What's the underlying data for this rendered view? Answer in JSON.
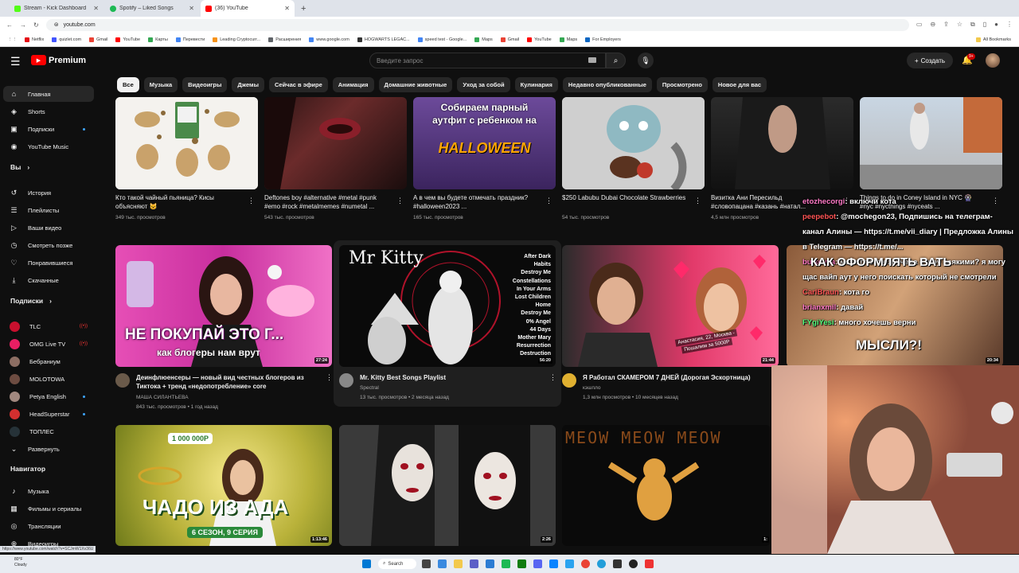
{
  "browser": {
    "tabs": [
      {
        "title": "Stream - Kick Dashboard",
        "color": "#53fc18"
      },
      {
        "title": "Spotify – Liked Songs",
        "color": "#1db954"
      },
      {
        "title": "(36) YouTube",
        "color": "#ff0000"
      }
    ],
    "url": "youtube.com",
    "bookmarks": [
      {
        "label": "Netflix",
        "color": "#e50914"
      },
      {
        "label": "quizlet.com",
        "color": "#4255ff"
      },
      {
        "label": "Gmail",
        "color": "#ea4335"
      },
      {
        "label": "YouTube",
        "color": "#ff0000"
      },
      {
        "label": "Карты",
        "color": "#34a853"
      },
      {
        "label": "Перевести",
        "color": "#4285f4"
      },
      {
        "label": "Leading Cryptocurr...",
        "color": "#f7931a"
      },
      {
        "label": "Расширения",
        "color": "#5f6368"
      },
      {
        "label": "www.google.com",
        "color": "#4285f4"
      },
      {
        "label": "HOGWARTS LEGAC...",
        "color": "#333333"
      },
      {
        "label": "speed test - Google...",
        "color": "#4285f4"
      },
      {
        "label": "Maps",
        "color": "#34a853"
      },
      {
        "label": "Gmail",
        "color": "#ea4335"
      },
      {
        "label": "YouTube",
        "color": "#ff0000"
      },
      {
        "label": "Maps",
        "color": "#34a853"
      },
      {
        "label": "For Employers",
        "color": "#0a66c2"
      }
    ],
    "all_bookmarks": "All Bookmarks",
    "status_url": "https://www.youtube.com/watch?v=SCJmW1Xv36U"
  },
  "header": {
    "logo_text": "Premium",
    "search_placeholder": "Введите запрос",
    "create_label": "Создать",
    "notif_badge": "9+"
  },
  "chips": [
    "Все",
    "Музыка",
    "Видеоигры",
    "Джемы",
    "Сейчас в эфире",
    "Анимация",
    "Домашние животные",
    "Уход за собой",
    "Кулинария",
    "Недавно опубликованные",
    "Просмотрено",
    "Новое для вас"
  ],
  "sidebar": {
    "main": [
      {
        "label": "Главная",
        "icon": "⌂"
      },
      {
        "label": "Shorts",
        "icon": "◈"
      },
      {
        "label": "Подписки",
        "icon": "▣"
      },
      {
        "label": "YouTube Music",
        "icon": "◉"
      }
    ],
    "you_label": "Вы",
    "you": [
      {
        "label": "История",
        "icon": "↺"
      },
      {
        "label": "Плейлисты",
        "icon": "☰"
      },
      {
        "label": "Ваши видео",
        "icon": "▷"
      },
      {
        "label": "Смотреть позже",
        "icon": "◷"
      },
      {
        "label": "Понравившиеся",
        "icon": "♡"
      },
      {
        "label": "Скачанные",
        "icon": "⤓"
      }
    ],
    "subs_label": "Подписки",
    "subs": [
      {
        "label": "TLC",
        "color": "#c8102e"
      },
      {
        "label": "OMG Live TV",
        "color": "#e91e63"
      },
      {
        "label": "Бебраниум",
        "color": "#8d6e63"
      },
      {
        "label": "MOLOTOWA",
        "color": "#6d4c41"
      },
      {
        "label": "Petya English",
        "color": "#a1887f"
      },
      {
        "label": "HeadSuperstar",
        "color": "#d32f2f"
      },
      {
        "label": "ТОПЛЕС",
        "color": "#263238"
      }
    ],
    "expand_label": "Развернуть",
    "nav_label": "Навигатор",
    "nav": [
      {
        "label": "Музыка",
        "icon": "♪"
      },
      {
        "label": "Фильмы и сериалы",
        "icon": "▦"
      },
      {
        "label": "Трансляции",
        "icon": "◎"
      },
      {
        "label": "Видеоигры",
        "icon": "⊕"
      }
    ]
  },
  "shorts": [
    {
      "title": "Кто такой чайный пьяница? Кисы объясняют 😺",
      "views": "349 тыс. просмотров"
    },
    {
      "title": "Deftones boy #alternative #metal #punk #emo #rock #metalmemes #numetal ...",
      "views": "543 тыс. просмотров"
    },
    {
      "title": "А в чем вы будете отмечать праздник? #halloween2023 ...",
      "views": "165 тыс. просмотров"
    },
    {
      "title": "$250 Labubu Dubai Chocolate Strawberries",
      "views": "54 тыс. просмотров"
    },
    {
      "title": "Визитка Ани Пересильд #словопацана #казань #натал...",
      "views": "4,5 млн просмотров"
    },
    {
      "title": "Things to do in Coney Island in NYC 🎡 #nyc #nycthings #nyceats ...",
      "views": ""
    }
  ],
  "short_overlay": {
    "line1": "Собираем парный",
    "line2": "аутфит с ребенком на",
    "line3": "HALLOWEEN"
  },
  "videos": [
    {
      "title": "Деинфлюенсеры — новый вид честных блогеров из Тиктока + тренд «недопотребление» core",
      "channel": "МАША СИЛАНТЬЕВА",
      "meta": "843 тыс. просмотров • 1 год назад",
      "duration": "27:24",
      "overlay1": "НЕ ПОКУПАЙ ЭТО Г...",
      "overlay2": "как блогеры нам врут"
    },
    {
      "title": "Mr. Kitty Best Songs Playlist",
      "channel": "Spectral",
      "meta": "13 тыс. просмотров • 2 месяца назад",
      "duration": "56:20",
      "overlay1": "Mr Kitty",
      "overlay2": "After Dark\nHabits\nDestroy Me\nConstellations\nIn Your Arms\nLost Children\nHome\nDestroy Me\n0% Angel\n44 Days\nMother Mary\nResurrection\nDestruction"
    },
    {
      "title": "Я Работал СКАМЕРОМ 7 ДНЕЙ (Дорогая Эскортница)",
      "channel": "кэшпло",
      "meta": "1,3 млн просмотров • 10 месяцев назад",
      "duration": "21:44",
      "overlay1": "Анастасия, 22, Москва -",
      "overlay2": "Пошалим за 5000Р"
    },
    {
      "title": "",
      "channel": "",
      "meta": "",
      "duration": "20:34",
      "overlay1": "КАК ОФОРМЛЯТЬ ВАТЬ",
      "overlay2": "МЫСЛИ?!"
    }
  ],
  "videos_row3": [
    {
      "duration": "1:13:46",
      "overlay1": "ЧАДО ИЗ АДА",
      "overlay2": "6 СЕЗОН, 9 СЕРИЯ",
      "badge": "1 000 000Р"
    },
    {
      "duration": "2:26",
      "overlay1": "",
      "overlay2": ""
    },
    {
      "duration": "1:",
      "overlay1": "MEOW MEOW MEOW",
      "overlay2": ""
    }
  ],
  "chat": [
    {
      "user": "etozhecorgi",
      "text": "включи кота"
    },
    {
      "user": "peepebot",
      "text": "@mochegon23, Подпишись на телеграм-канал Алины — https://t.me/vii_diary | Предложка Алины в Telegram — https://t.me/..."
    },
    {
      "user": "bulkovka",
      "text": "может того озвучера с шоу всякими? я могу щас вайп аут у него поискать который не смотрели"
    },
    {
      "user": "CarlBraun",
      "text": "кота го"
    },
    {
      "user": "brianxmil",
      "text": "давай"
    },
    {
      "user": "FYgiYesi",
      "text": "много хочешь верни"
    }
  ],
  "taskbar": {
    "weather_temp": "80°F",
    "weather_text": "Cloudy",
    "search": "Search"
  }
}
